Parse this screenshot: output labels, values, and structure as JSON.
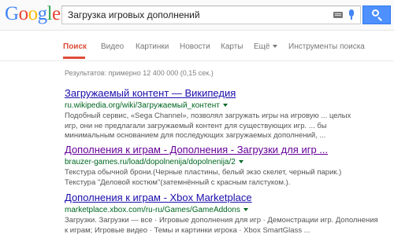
{
  "header": {
    "logo": "Google",
    "search_value": "Загрузка игровых дополнений"
  },
  "tabs": [
    {
      "label": "Поиск",
      "active": true
    },
    {
      "label": "Видео"
    },
    {
      "label": "Картинки"
    },
    {
      "label": "Новости"
    },
    {
      "label": "Карты"
    },
    {
      "label": "Ещё"
    },
    {
      "label": "Инструменты поиска"
    }
  ],
  "stats": "Результатов: примерно 12 400 000 (0,15 сек.)",
  "results": [
    {
      "title": "Загружаемый контент — Википедия",
      "url": "ru.wikipedia.org/wiki/Загружаемый_контент",
      "snippet": [
        "Подобный сервис, «Sega Channel», позволял загружать игры на игровую ... целых",
        "игр, они не предлагали загружаемый контент для существующих игр. ... бы",
        "минимальным основанием для последующих загружаемых дополнений, ..."
      ]
    },
    {
      "title": "Дополнения к играм - Дополнения - Загрузки для игр ...",
      "url": "brauzer-games.ru/load/dopolnenija/dopolnenija/2",
      "snippet": [
        "Текстура обычной брони.(Черные пластины, белый экзо скелет, черный парик.)",
        "Текстура \"Деловой костюм\"(затемнённый с красным галстуком.)."
      ]
    },
    {
      "title": "Дополнения к играм - Xbox Marketplace",
      "url": "marketplace.xbox.com/ru-ru/Games/GameAddons",
      "snippet": [
        "Загрузки. Загрузки — все · Игровые дополнения для игр · Демонстрации игр. Дополнения",
        "к играм; Игровые видео · Темы и картинки игрока · Xbox SmartGlass ..."
      ]
    }
  ]
}
